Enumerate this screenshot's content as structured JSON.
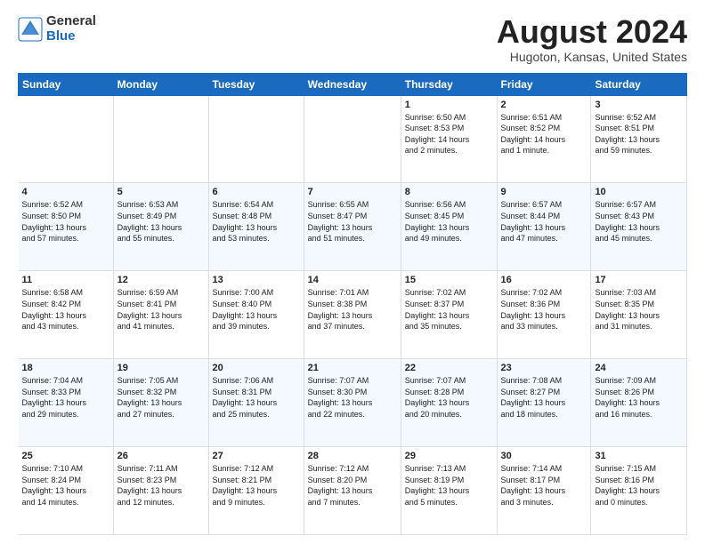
{
  "logo": {
    "general": "General",
    "blue": "Blue"
  },
  "title": "August 2024",
  "subtitle": "Hugoton, Kansas, United States",
  "headers": [
    "Sunday",
    "Monday",
    "Tuesday",
    "Wednesday",
    "Thursday",
    "Friday",
    "Saturday"
  ],
  "weeks": [
    [
      {
        "day": "",
        "info": ""
      },
      {
        "day": "",
        "info": ""
      },
      {
        "day": "",
        "info": ""
      },
      {
        "day": "",
        "info": ""
      },
      {
        "day": "1",
        "info": "Sunrise: 6:50 AM\nSunset: 8:53 PM\nDaylight: 14 hours\nand 2 minutes."
      },
      {
        "day": "2",
        "info": "Sunrise: 6:51 AM\nSunset: 8:52 PM\nDaylight: 14 hours\nand 1 minute."
      },
      {
        "day": "3",
        "info": "Sunrise: 6:52 AM\nSunset: 8:51 PM\nDaylight: 13 hours\nand 59 minutes."
      }
    ],
    [
      {
        "day": "4",
        "info": "Sunrise: 6:52 AM\nSunset: 8:50 PM\nDaylight: 13 hours\nand 57 minutes."
      },
      {
        "day": "5",
        "info": "Sunrise: 6:53 AM\nSunset: 8:49 PM\nDaylight: 13 hours\nand 55 minutes."
      },
      {
        "day": "6",
        "info": "Sunrise: 6:54 AM\nSunset: 8:48 PM\nDaylight: 13 hours\nand 53 minutes."
      },
      {
        "day": "7",
        "info": "Sunrise: 6:55 AM\nSunset: 8:47 PM\nDaylight: 13 hours\nand 51 minutes."
      },
      {
        "day": "8",
        "info": "Sunrise: 6:56 AM\nSunset: 8:45 PM\nDaylight: 13 hours\nand 49 minutes."
      },
      {
        "day": "9",
        "info": "Sunrise: 6:57 AM\nSunset: 8:44 PM\nDaylight: 13 hours\nand 47 minutes."
      },
      {
        "day": "10",
        "info": "Sunrise: 6:57 AM\nSunset: 8:43 PM\nDaylight: 13 hours\nand 45 minutes."
      }
    ],
    [
      {
        "day": "11",
        "info": "Sunrise: 6:58 AM\nSunset: 8:42 PM\nDaylight: 13 hours\nand 43 minutes."
      },
      {
        "day": "12",
        "info": "Sunrise: 6:59 AM\nSunset: 8:41 PM\nDaylight: 13 hours\nand 41 minutes."
      },
      {
        "day": "13",
        "info": "Sunrise: 7:00 AM\nSunset: 8:40 PM\nDaylight: 13 hours\nand 39 minutes."
      },
      {
        "day": "14",
        "info": "Sunrise: 7:01 AM\nSunset: 8:38 PM\nDaylight: 13 hours\nand 37 minutes."
      },
      {
        "day": "15",
        "info": "Sunrise: 7:02 AM\nSunset: 8:37 PM\nDaylight: 13 hours\nand 35 minutes."
      },
      {
        "day": "16",
        "info": "Sunrise: 7:02 AM\nSunset: 8:36 PM\nDaylight: 13 hours\nand 33 minutes."
      },
      {
        "day": "17",
        "info": "Sunrise: 7:03 AM\nSunset: 8:35 PM\nDaylight: 13 hours\nand 31 minutes."
      }
    ],
    [
      {
        "day": "18",
        "info": "Sunrise: 7:04 AM\nSunset: 8:33 PM\nDaylight: 13 hours\nand 29 minutes."
      },
      {
        "day": "19",
        "info": "Sunrise: 7:05 AM\nSunset: 8:32 PM\nDaylight: 13 hours\nand 27 minutes."
      },
      {
        "day": "20",
        "info": "Sunrise: 7:06 AM\nSunset: 8:31 PM\nDaylight: 13 hours\nand 25 minutes."
      },
      {
        "day": "21",
        "info": "Sunrise: 7:07 AM\nSunset: 8:30 PM\nDaylight: 13 hours\nand 22 minutes."
      },
      {
        "day": "22",
        "info": "Sunrise: 7:07 AM\nSunset: 8:28 PM\nDaylight: 13 hours\nand 20 minutes."
      },
      {
        "day": "23",
        "info": "Sunrise: 7:08 AM\nSunset: 8:27 PM\nDaylight: 13 hours\nand 18 minutes."
      },
      {
        "day": "24",
        "info": "Sunrise: 7:09 AM\nSunset: 8:26 PM\nDaylight: 13 hours\nand 16 minutes."
      }
    ],
    [
      {
        "day": "25",
        "info": "Sunrise: 7:10 AM\nSunset: 8:24 PM\nDaylight: 13 hours\nand 14 minutes."
      },
      {
        "day": "26",
        "info": "Sunrise: 7:11 AM\nSunset: 8:23 PM\nDaylight: 13 hours\nand 12 minutes."
      },
      {
        "day": "27",
        "info": "Sunrise: 7:12 AM\nSunset: 8:21 PM\nDaylight: 13 hours\nand 9 minutes."
      },
      {
        "day": "28",
        "info": "Sunrise: 7:12 AM\nSunset: 8:20 PM\nDaylight: 13 hours\nand 7 minutes."
      },
      {
        "day": "29",
        "info": "Sunrise: 7:13 AM\nSunset: 8:19 PM\nDaylight: 13 hours\nand 5 minutes."
      },
      {
        "day": "30",
        "info": "Sunrise: 7:14 AM\nSunset: 8:17 PM\nDaylight: 13 hours\nand 3 minutes."
      },
      {
        "day": "31",
        "info": "Sunrise: 7:15 AM\nSunset: 8:16 PM\nDaylight: 13 hours\nand 0 minutes."
      }
    ]
  ]
}
